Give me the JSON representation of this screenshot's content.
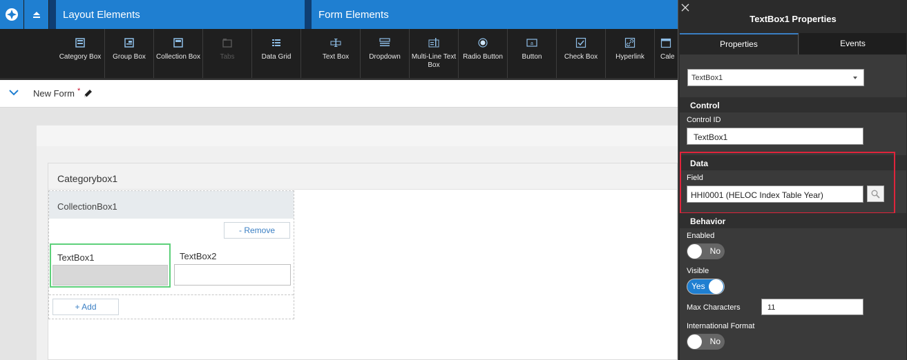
{
  "ribbon": {
    "layout_title": "Layout Elements",
    "form_title": "Form Elements",
    "layout_tools": [
      {
        "label": "Category Box",
        "icon": "category-box-icon",
        "enabled": true
      },
      {
        "label": "Group Box",
        "icon": "group-box-icon",
        "enabled": true
      },
      {
        "label": "Collection Box",
        "icon": "collection-box-icon",
        "enabled": true
      },
      {
        "label": "Tabs",
        "icon": "tabs-icon",
        "enabled": false
      },
      {
        "label": "Data Grid",
        "icon": "data-grid-icon",
        "enabled": true
      }
    ],
    "form_tools": [
      {
        "label": "Text Box",
        "icon": "text-box-icon"
      },
      {
        "label": "Dropdown",
        "icon": "dropdown-icon"
      },
      {
        "label": "Multi-Line Text Box",
        "icon": "multiline-text-box-icon"
      },
      {
        "label": "Radio Button",
        "icon": "radio-button-icon"
      },
      {
        "label": "Button",
        "icon": "button-icon"
      },
      {
        "label": "Check Box",
        "icon": "check-box-icon"
      },
      {
        "label": "Hyperlink",
        "icon": "hyperlink-icon"
      },
      {
        "label": "Cale",
        "icon": "calendar-icon"
      }
    ]
  },
  "form": {
    "title": "New Form",
    "required_marker": "*"
  },
  "canvas": {
    "category_box_label": "Categorybox1",
    "collection_box_label": "CollectionBox1",
    "remove_label": "- Remove",
    "add_label": "+ Add",
    "textbox1_label": "TextBox1",
    "textbox2_label": "TextBox2"
  },
  "properties": {
    "title": "TextBox1 Properties",
    "tabs": [
      "Properties",
      "Events"
    ],
    "control_select_value": "TextBox1",
    "control_group": "Control",
    "control_id_label": "Control ID",
    "control_id_value": "TextBox1",
    "data_group": "Data",
    "field_label": "Field",
    "field_value": "HHI0001 (HELOC Index Table Year)",
    "behavior_group": "Behavior",
    "enabled_label": "Enabled",
    "enabled_value": "No",
    "visible_label": "Visible",
    "visible_value": "Yes",
    "max_chars_label": "Max Characters",
    "max_chars_value": "11",
    "intl_format_label": "International Format",
    "intl_format_value": "No"
  },
  "colors": {
    "ribbon_blue": "#1f7fd1",
    "selected_outline": "#5dd07a",
    "highlight_red": "#e0243b",
    "link_blue": "#3a7fc4"
  }
}
